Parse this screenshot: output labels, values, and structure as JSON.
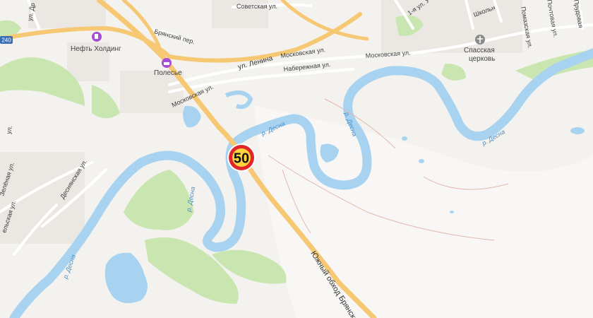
{
  "streets": {
    "sovetskaya": "Советская ул.",
    "lenina": "ул. Ленина",
    "moskovskaya_1": "Московская ул.",
    "moskovskaya_2": "Московская ул.",
    "moskovskaya_3": "Московская ул.",
    "bryansky_per": "Брянский пер.",
    "naberezhnaya": "Набережная ул.",
    "desnyanskaya": "Деснянская ул.",
    "zelenaya": "Зелёная ул.",
    "1a_ul": "1-я ул. У",
    "shkolnaya": "Школьн",
    "pochtovaya": "Почтовая ул.",
    "pomazkaya": "Помазская ул.",
    "prudovaya": "Прудовая",
    "ul_dr": "ул. Др",
    "elskaya": "ельская ул.",
    "ul_left": "ул."
  },
  "water": {
    "desna_1": "р. Десна",
    "desna_2": "р. Десна",
    "desna_3": "р. Десна",
    "desna_4": "р. Десна",
    "desna_5": "р. Десна"
  },
  "poi": {
    "neft": "Нефть Холдинг",
    "polesye": "Полесье",
    "church_1": "Спасская",
    "church_2": "церковь"
  },
  "highway": {
    "name": "Южный обход Брянска",
    "shield": "240"
  },
  "speed_limit": "50",
  "colors": {
    "land": "#f4f2ee",
    "water": "#a8d3f0",
    "forest": "#c9e6b0",
    "main_road": "#f7c873",
    "road": "#ffffff",
    "speed_ring": "#e0262b",
    "speed_fill": "#ffd33d",
    "poi_icon": "#a64fd6",
    "church_icon": "#8a8a8a"
  }
}
